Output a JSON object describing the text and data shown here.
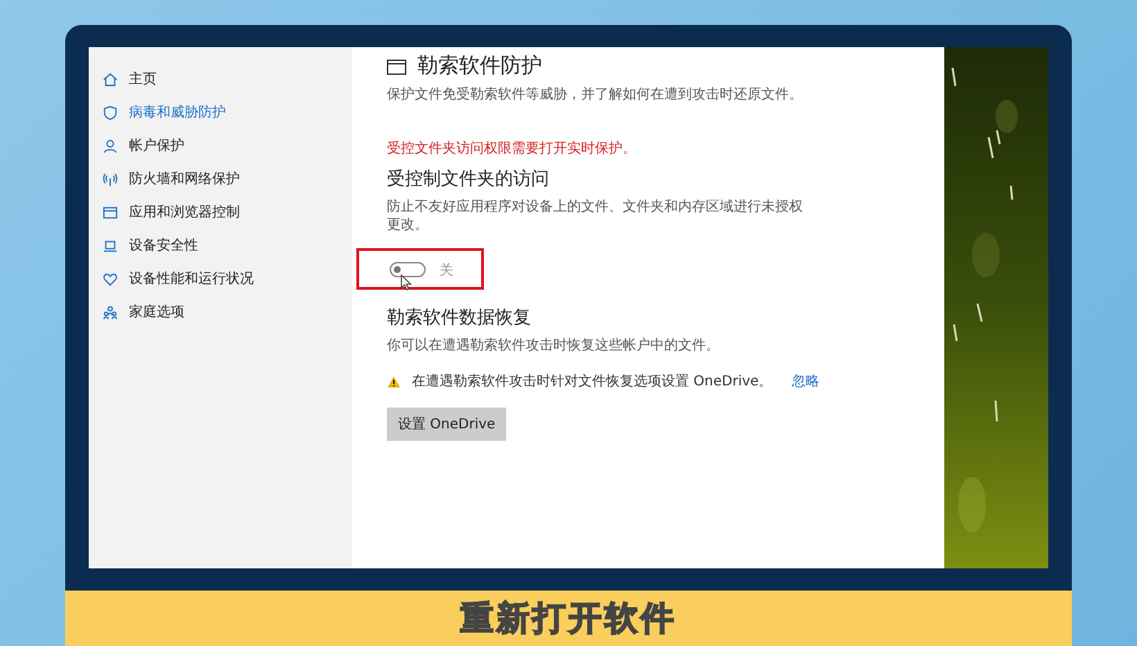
{
  "sidebar": {
    "items": [
      {
        "label": "主页",
        "selected": false
      },
      {
        "label": "病毒和威胁防护",
        "selected": true
      },
      {
        "label": "帐户保护",
        "selected": false
      },
      {
        "label": "防火墙和网络保护",
        "selected": false
      },
      {
        "label": "应用和浏览器控制",
        "selected": false
      },
      {
        "label": "设备安全性",
        "selected": false
      },
      {
        "label": "设备性能和运行状况",
        "selected": false
      },
      {
        "label": "家庭选项",
        "selected": false
      }
    ]
  },
  "section": {
    "title": "勒索软件防护",
    "description": "保护文件免受勒索软件等威胁，并了解如何在遭到攻击时还原文件。"
  },
  "warning_text": "受控文件夹访问权限需要打开实时保护。",
  "folder_access": {
    "title": "受控制文件夹的访问",
    "description": "防止不友好应用程序对设备上的文件、文件夹和内存区域进行未授权更改。",
    "toggle": {
      "on": false,
      "label": "关"
    }
  },
  "recovery": {
    "title": "勒索软件数据恢复",
    "description": "你可以在遭遇勒索软件攻击时恢复这些帐户中的文件。",
    "notice": "在遭遇勒索软件攻击时针对文件恢复选项设置 OneDrive。",
    "dismiss_link": "忽略",
    "button": "设置 OneDrive"
  },
  "caption": "重新打开软件"
}
